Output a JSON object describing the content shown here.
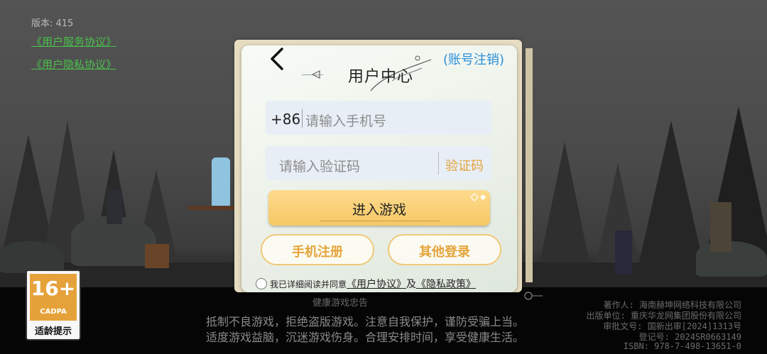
{
  "version_line": "版本: 415",
  "links": {
    "service_agreement": "《用户服务协议》",
    "privacy_agreement": "《用户隐私协议》"
  },
  "panel": {
    "title": "用户中心",
    "cancel_account": "(账号注销)",
    "phone_prefix": "+86",
    "phone_placeholder": "请输入手机号",
    "code_placeholder": "请输入验证码",
    "get_code": "验证码",
    "enter_game": "进入游戏",
    "phone_register": "手机注册",
    "other_login": "其他登录",
    "agree_text": "我已详细阅读并同意",
    "user_agreement": "《用户协议》",
    "and": "及",
    "privacy_policy": "《隐私政策》"
  },
  "rating": {
    "age": "16+",
    "org": "CADPA",
    "tip": "适龄提示"
  },
  "notice": {
    "title": "健康游戏忠告",
    "line1": "抵制不良游戏，拒绝盗版游戏。注意自我保护，谨防受骗上当。",
    "line2": "适度游戏益脑，沉迷游戏伤身。合理安排时间，享受健康生活。"
  },
  "credits": {
    "author": "著作人: 海南赫坤网络科技有限公司",
    "publisher": "出版单位: 重庆华龙网集团股份有限公司",
    "approval": "审批文号: 国新出审[2024]1313号",
    "registration": "登记号: 2024SR0663149",
    "isbn": "ISBN: 978-7-498-13651-0"
  },
  "colors": {
    "accent_blue": "#2b8fd9",
    "accent_gold": "#e5a43a",
    "button_yellow": "#f6c866",
    "link_green": "#4cc04c"
  }
}
